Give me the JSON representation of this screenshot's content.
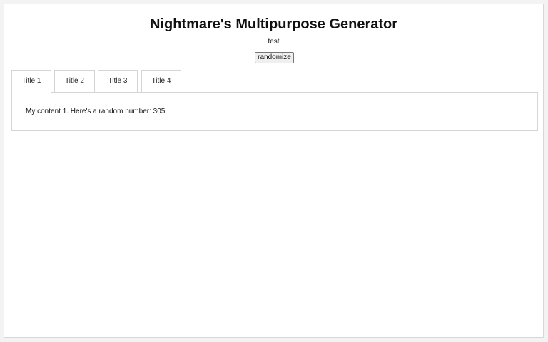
{
  "header": {
    "title": "Nightmare's Multipurpose Generator",
    "subtitle": "test",
    "randomize_label": "randomize"
  },
  "tabs": [
    {
      "label": "Title 1",
      "active": true
    },
    {
      "label": "Title 2",
      "active": false
    },
    {
      "label": "Title 3",
      "active": false
    },
    {
      "label": "Title 4",
      "active": false
    }
  ],
  "panel": {
    "content_prefix": "My content 1. Here's a random number: ",
    "random_number": "305"
  },
  "colors": {
    "page_background": "#ffffff",
    "outer_background": "#f3f3f3",
    "border": "#d5d5d5",
    "text": "#111111"
  }
}
